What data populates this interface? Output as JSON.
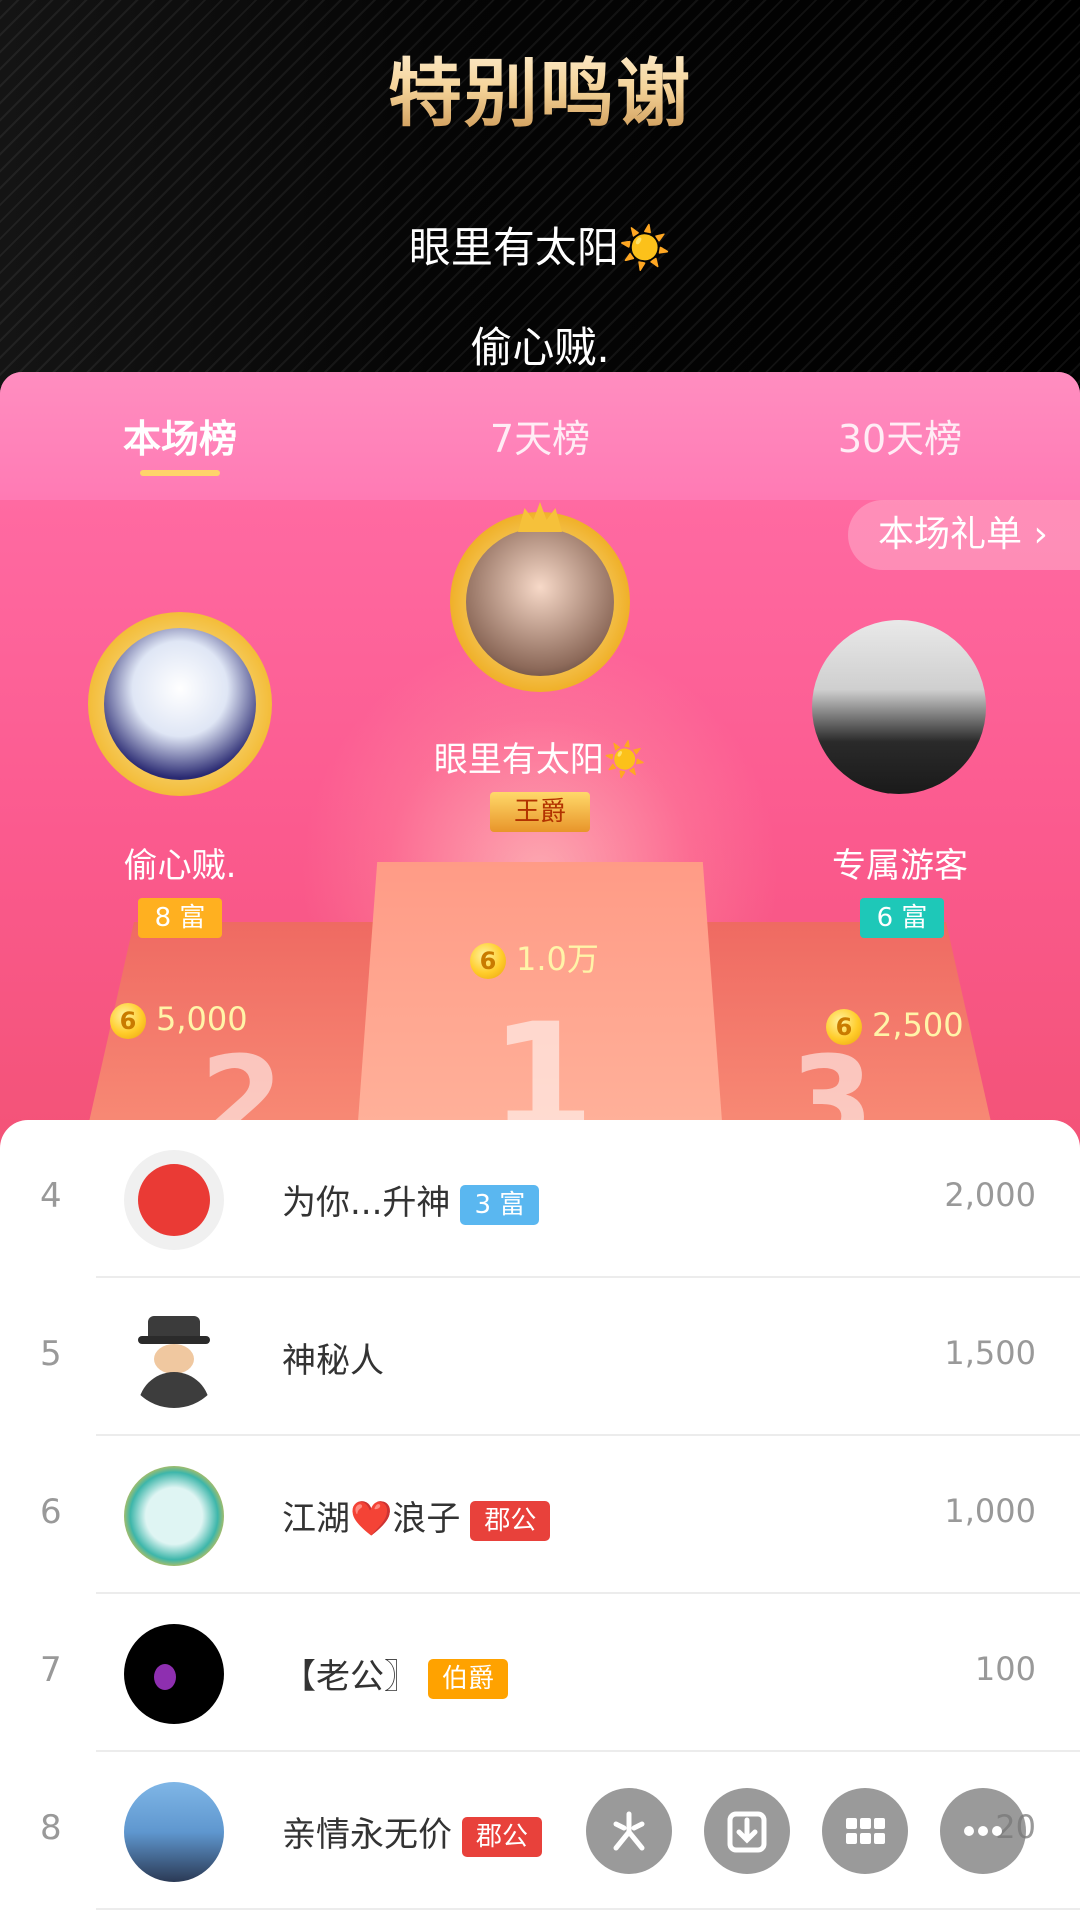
{
  "header": {
    "title": "特别鸣谢",
    "thanks": [
      "眼里有太阳☀️",
      "偷心贼."
    ]
  },
  "tabs": [
    {
      "label": "本场榜",
      "active": true
    },
    {
      "label": "7天榜",
      "active": false
    },
    {
      "label": "30天榜",
      "active": false
    }
  ],
  "gift_list_label": "本场礼单 ›",
  "podium": {
    "first": {
      "name": "眼里有太阳☀️",
      "badge": "王爵",
      "coin_icon": "6",
      "value": "1.0万"
    },
    "second": {
      "name": "偷心贼.",
      "badge": "8 富",
      "coin_icon": "6",
      "value": "5,000"
    },
    "third": {
      "name": "专属游客",
      "badge": "6 富",
      "coin_icon": "6",
      "value": "2,500"
    },
    "numbers": [
      "1",
      "2",
      "3"
    ]
  },
  "list": [
    {
      "rank": "4",
      "name": "为你...升神",
      "badge": "3 富",
      "value": "2,000"
    },
    {
      "rank": "5",
      "name": "神秘人",
      "badge": "",
      "value": "1,500"
    },
    {
      "rank": "6",
      "name": "江湖❤️浪子",
      "badge": "郡公",
      "value": "1,000"
    },
    {
      "rank": "7",
      "name": "【老公〗",
      "badge": "伯爵",
      "value": "100"
    },
    {
      "rank": "8",
      "name": "亲情永无价",
      "badge": "郡公",
      "value": "20"
    }
  ],
  "colors": {
    "accent": "#ff6aa2",
    "badge_wealth_8": "#ffb020",
    "badge_wealth_6": "#1ec8b8",
    "badge_wealth_3": "#5ab7f0",
    "badge_noble": "#e8413b",
    "badge_earl": "#ffa200"
  },
  "fab_icons": [
    "asterisk-icon",
    "download-icon",
    "grid-icon",
    "more-icon"
  ]
}
